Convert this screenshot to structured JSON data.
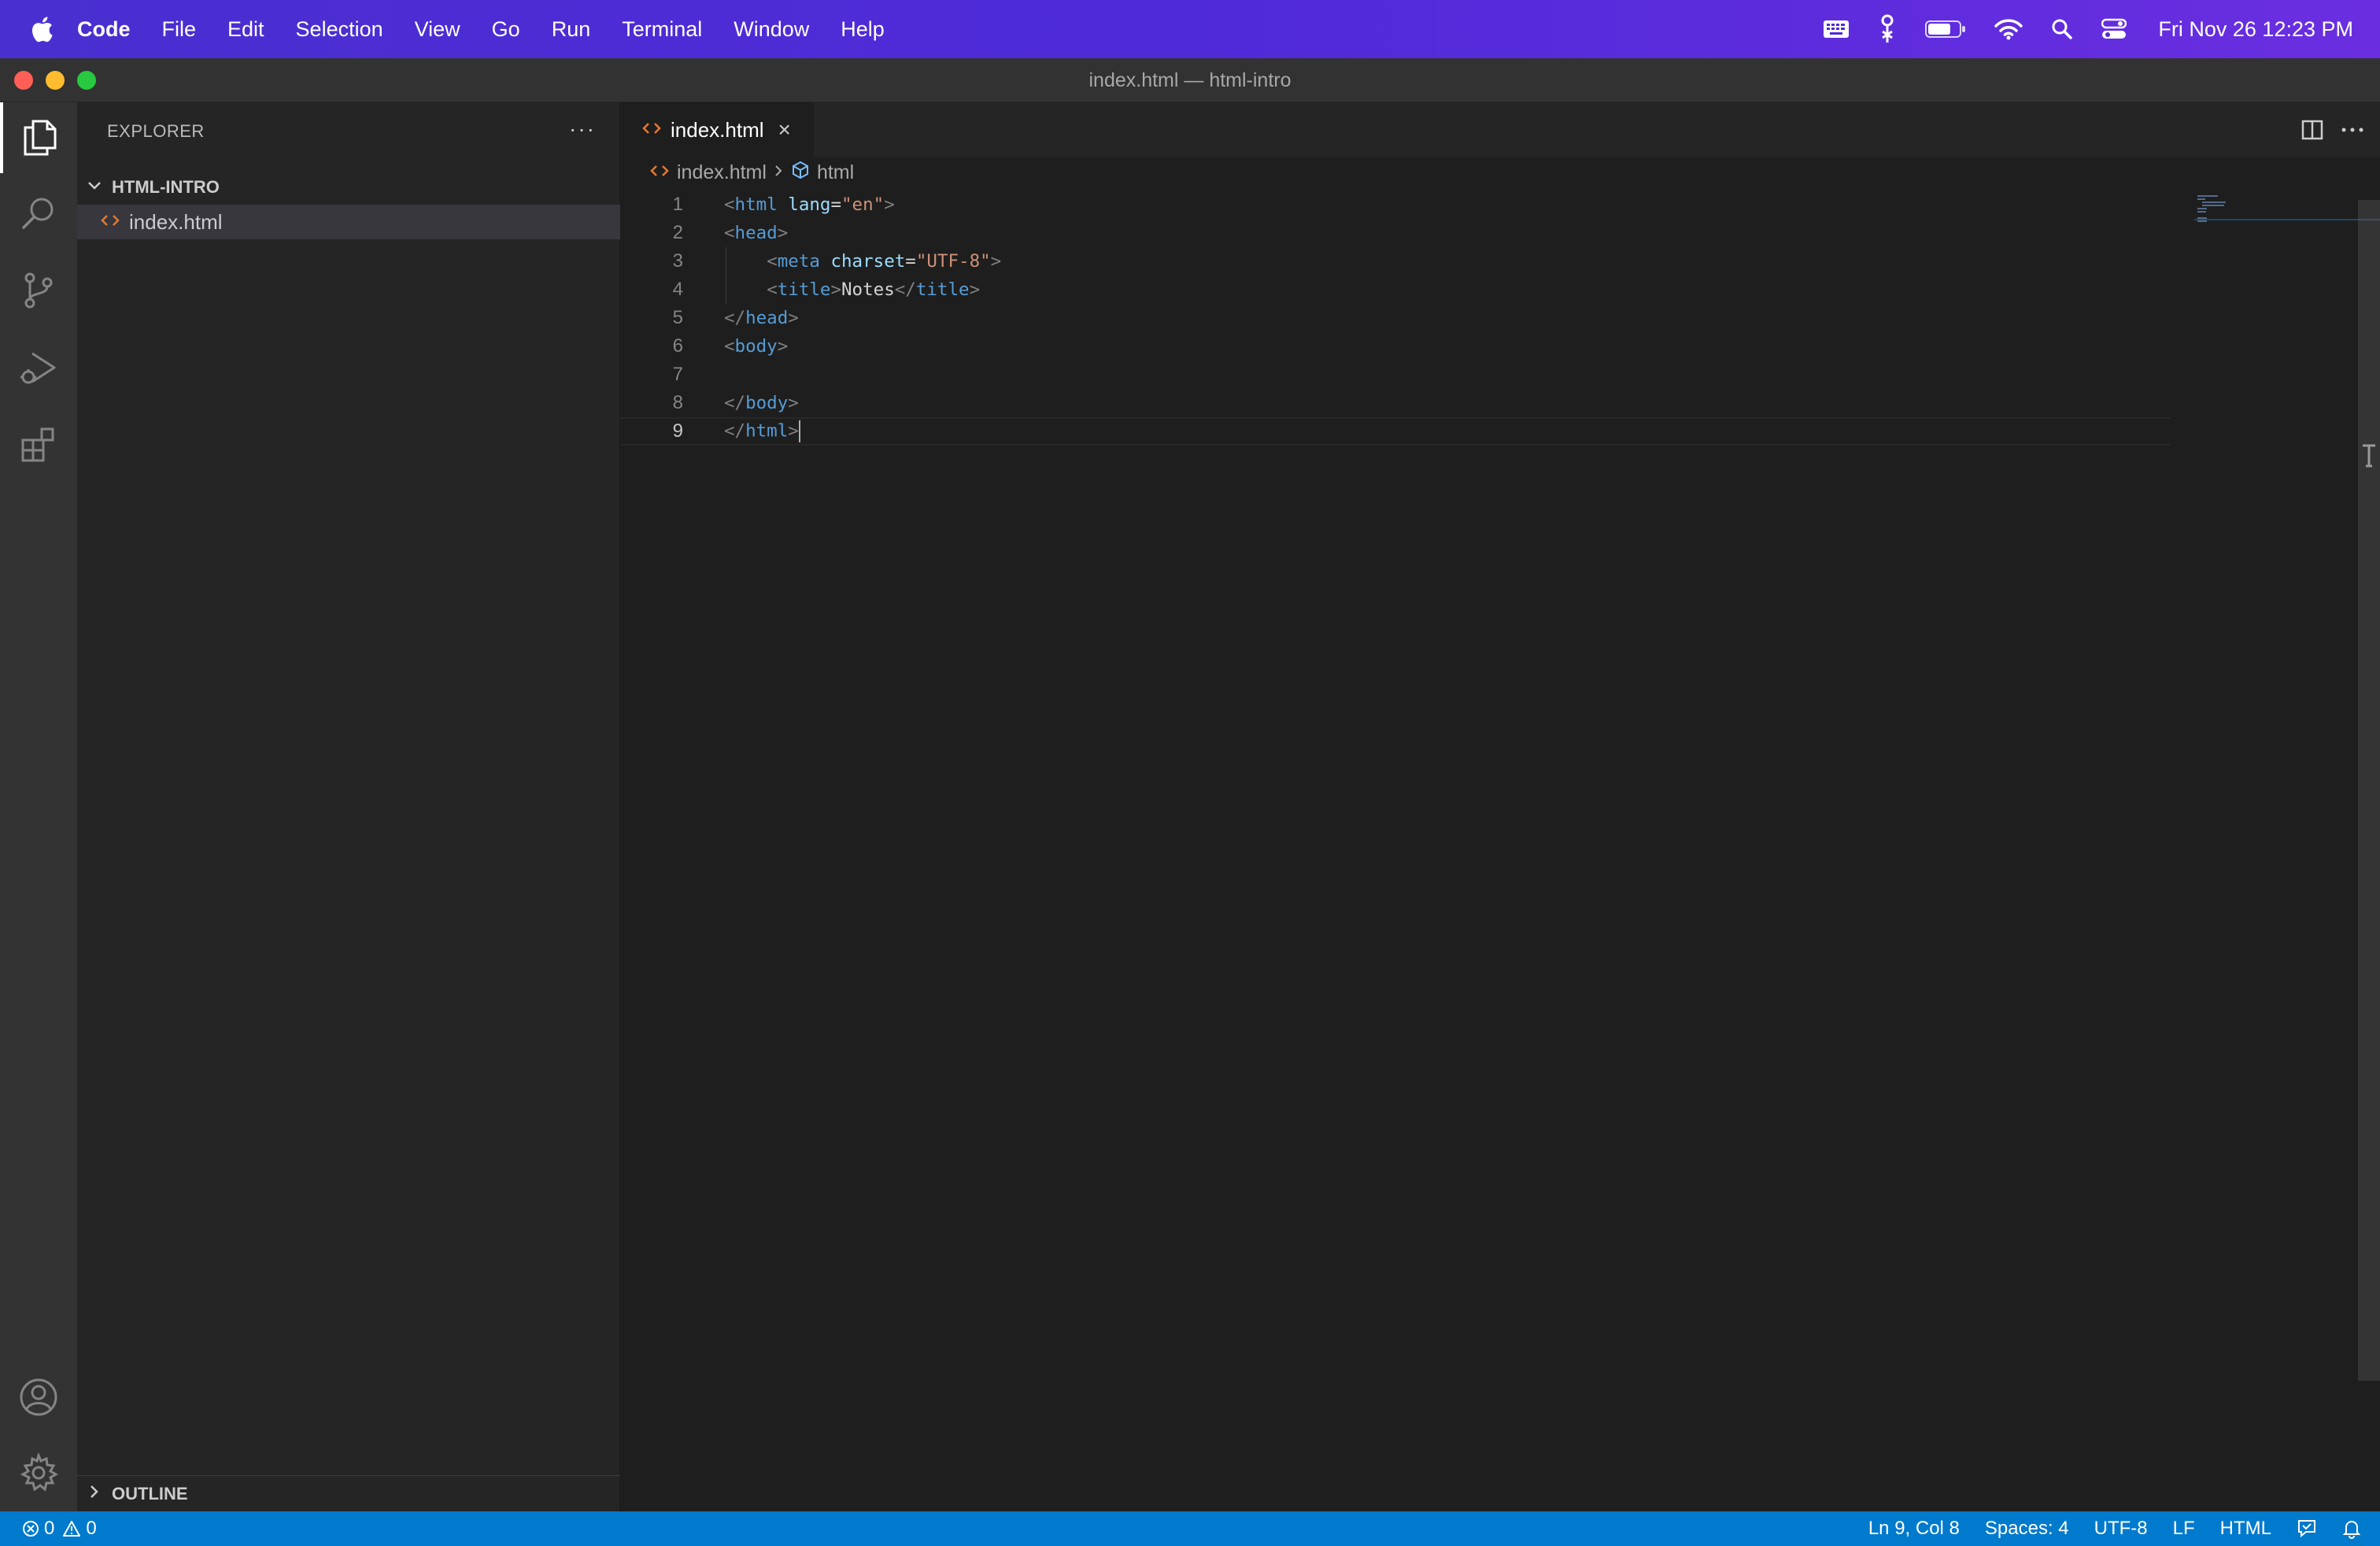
{
  "menubar": {
    "app_name": "Code",
    "items": [
      "File",
      "Edit",
      "Selection",
      "View",
      "Go",
      "Run",
      "Terminal",
      "Window",
      "Help"
    ],
    "clock": "Fri Nov 26  12:23 PM"
  },
  "window": {
    "title": "index.html — html-intro"
  },
  "sidebar": {
    "header": "EXPLORER",
    "more": "···",
    "folder_name": "HTML-INTRO",
    "files": [
      {
        "name": "index.html"
      }
    ],
    "outline_label": "OUTLINE"
  },
  "editor": {
    "tab_label": "index.html",
    "tab_close": "×",
    "breadcrumb": {
      "file": "index.html",
      "symbol": "html"
    },
    "lines": [
      {
        "n": "1",
        "tokens": [
          [
            "t-tag",
            "<"
          ],
          [
            "t-name",
            "html"
          ],
          [
            "t-text",
            " "
          ],
          [
            "t-attr",
            "lang"
          ],
          [
            "t-text",
            "="
          ],
          [
            "t-val",
            "\"en\""
          ],
          [
            "t-tag",
            ">"
          ]
        ]
      },
      {
        "n": "2",
        "tokens": [
          [
            "t-tag",
            "<"
          ],
          [
            "t-name",
            "head"
          ],
          [
            "t-tag",
            ">"
          ]
        ]
      },
      {
        "n": "3",
        "tokens": [
          [
            "t-text",
            "    "
          ],
          [
            "t-tag",
            "<"
          ],
          [
            "t-name",
            "meta"
          ],
          [
            "t-text",
            " "
          ],
          [
            "t-attr",
            "charset"
          ],
          [
            "t-text",
            "="
          ],
          [
            "t-val",
            "\"UTF-8\""
          ],
          [
            "t-tag",
            ">"
          ]
        ]
      },
      {
        "n": "4",
        "tokens": [
          [
            "t-text",
            "    "
          ],
          [
            "t-tag",
            "<"
          ],
          [
            "t-name",
            "title"
          ],
          [
            "t-tag",
            ">"
          ],
          [
            "t-text",
            "Notes"
          ],
          [
            "t-tag",
            "</"
          ],
          [
            "t-name",
            "title"
          ],
          [
            "t-tag",
            ">"
          ]
        ]
      },
      {
        "n": "5",
        "tokens": [
          [
            "t-tag",
            "</"
          ],
          [
            "t-name",
            "head"
          ],
          [
            "t-tag",
            ">"
          ]
        ]
      },
      {
        "n": "6",
        "tokens": [
          [
            "t-tag",
            "<"
          ],
          [
            "t-name",
            "body"
          ],
          [
            "t-tag",
            ">"
          ]
        ]
      },
      {
        "n": "7",
        "tokens": []
      },
      {
        "n": "8",
        "tokens": [
          [
            "t-tag",
            "</"
          ],
          [
            "t-name",
            "body"
          ],
          [
            "t-tag",
            ">"
          ]
        ]
      },
      {
        "n": "9",
        "tokens": [
          [
            "t-tag",
            "</"
          ],
          [
            "t-name",
            "html"
          ],
          [
            "t-tag",
            ">"
          ]
        ]
      }
    ],
    "current_line": "9"
  },
  "statusbar": {
    "errors": "0",
    "warnings": "0",
    "position": "Ln 9, Col 8",
    "spaces": "Spaces: 4",
    "encoding": "UTF-8",
    "eol": "LF",
    "language": "HTML"
  },
  "colors": {
    "accent": "#007acc",
    "html_file_icon": "#e37933",
    "menubar": "#4f2ad9"
  },
  "icons": {
    "activity": [
      "explorer-icon",
      "search-icon",
      "source-control-icon",
      "run-debug-icon",
      "extensions-icon",
      "accounts-icon",
      "settings-gear-icon"
    ]
  }
}
